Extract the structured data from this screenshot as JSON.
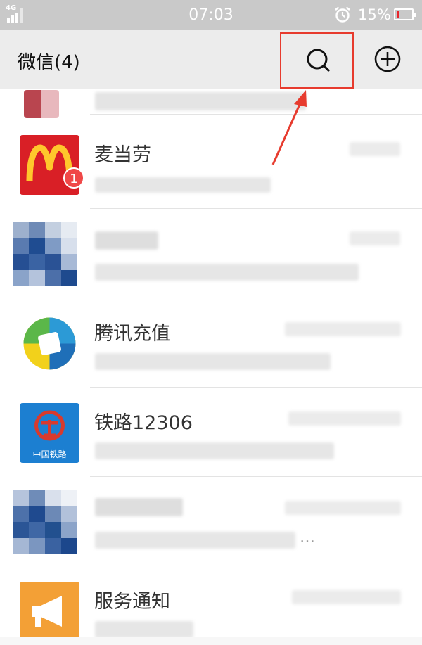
{
  "status_bar": {
    "network": "4G",
    "time": "07:03",
    "alarm_icon": "alarm-clock-icon",
    "battery_percent": "15%",
    "battery_level": 0.15,
    "battery_color": "#e8262b"
  },
  "header": {
    "title": "微信(4)",
    "search_icon": "search-icon",
    "add_icon": "plus-circle-icon",
    "highlight_color": "#e73b2e"
  },
  "chats": [
    {
      "name": "",
      "avatar": "blurred-avatar",
      "blurred": true
    },
    {
      "name": "麦当劳",
      "avatar": "mcdonalds-logo-icon",
      "unread_badge": "1"
    },
    {
      "name": "",
      "avatar": "pixelated-avatar",
      "blurred": true
    },
    {
      "name": "腾讯充值",
      "avatar": "tencent-recharge-logo-icon"
    },
    {
      "name": "铁路12306",
      "avatar": "china-railway-logo-icon",
      "avatar_text": "中国铁路",
      "preview_ellipsis": "…"
    },
    {
      "name": "",
      "avatar": "pixelated-avatar",
      "blurred": true,
      "preview_ellipsis": "…"
    },
    {
      "name": "服务通知",
      "avatar": "megaphone-icon"
    }
  ]
}
